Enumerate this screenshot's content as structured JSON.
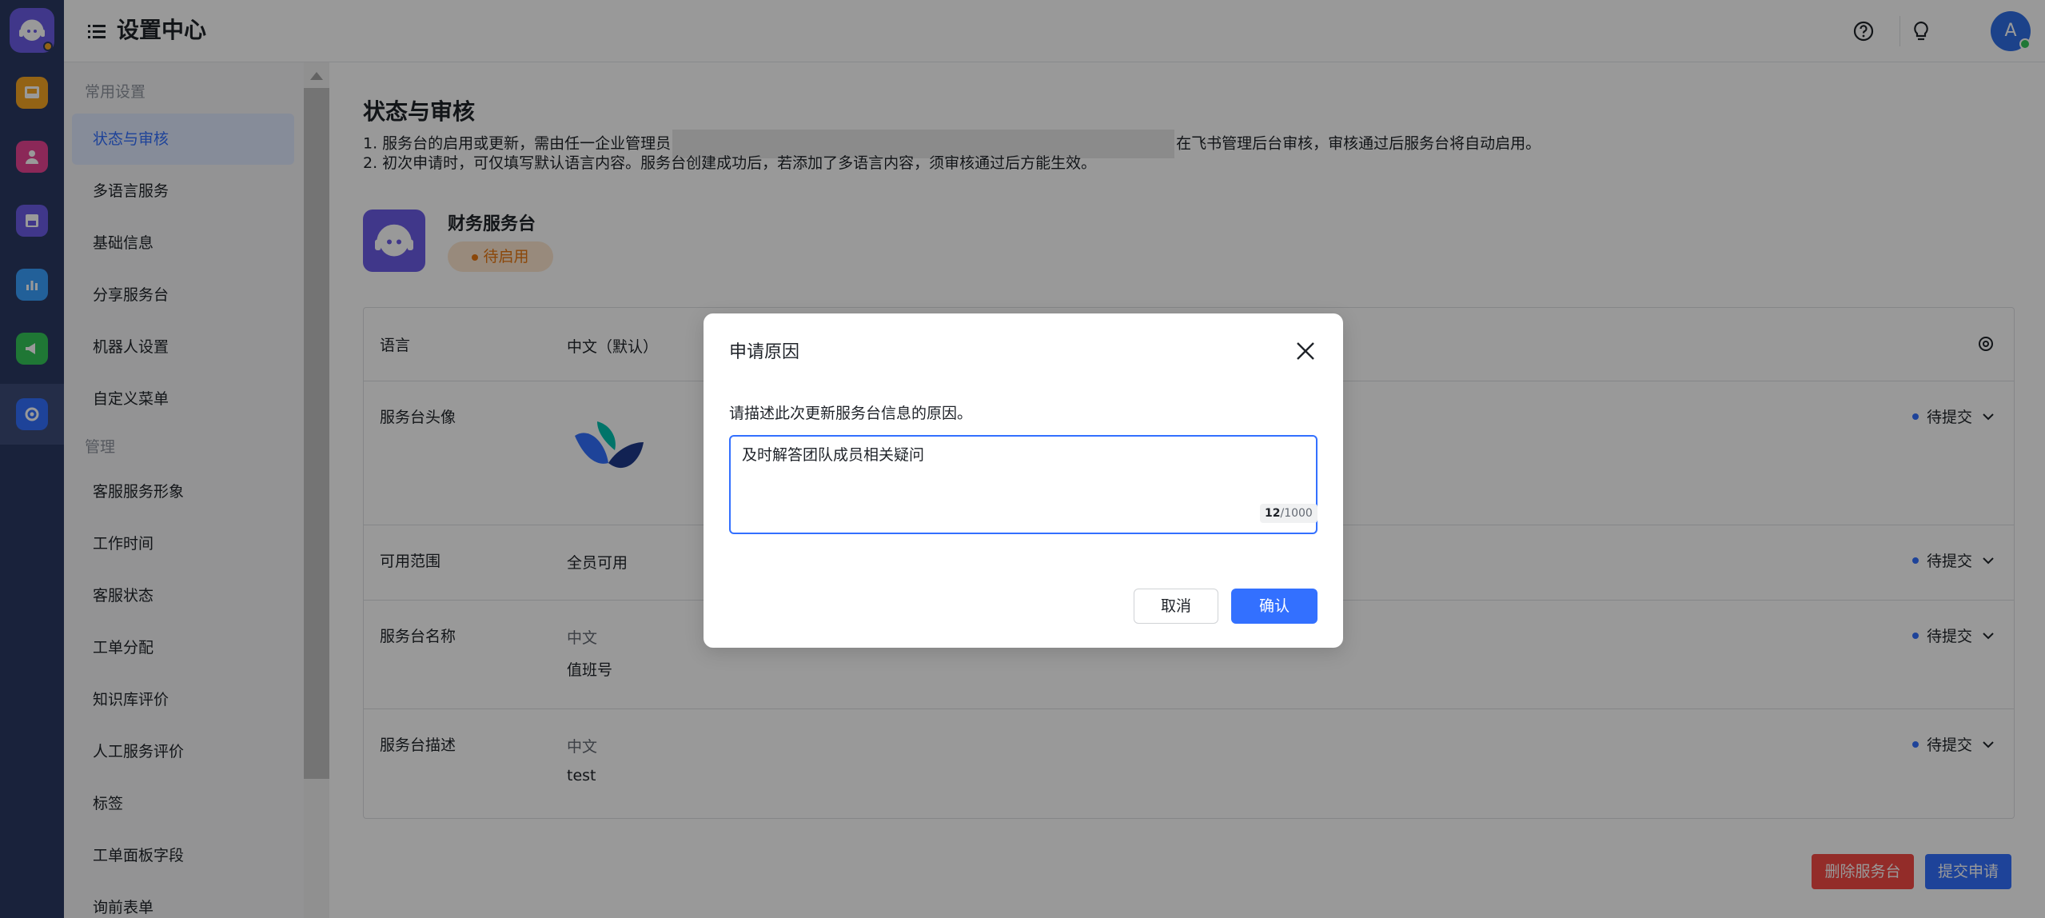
{
  "header": {
    "title": "设置中心",
    "avatar_letter": "A"
  },
  "sidebar": {
    "group_common": "常用设置",
    "group_manage": "管理",
    "items": [
      {
        "label": "状态与审核"
      },
      {
        "label": "多语言服务"
      },
      {
        "label": "基础信息"
      },
      {
        "label": "分享服务台"
      },
      {
        "label": "机器人设置"
      },
      {
        "label": "自定义菜单"
      },
      {
        "label": "客服服务形象"
      },
      {
        "label": "工作时间"
      },
      {
        "label": "客服状态"
      },
      {
        "label": "工单分配"
      },
      {
        "label": "知识库评价"
      },
      {
        "label": "人工服务评价"
      },
      {
        "label": "标签"
      },
      {
        "label": "工单面板字段"
      },
      {
        "label": "询前表单"
      }
    ]
  },
  "main": {
    "section_title": "状态与审核",
    "note1_prefix": "1. 服务台的启用或更新，需由任一企业管理员",
    "note1_suffix": "在飞书管理后台审核，审核通过后服务台将自动启用。",
    "note2": "2. 初次申请时，可仅填写默认语言内容。服务台创建成功后，若添加了多语言内容，须审核通过后方能生效。",
    "desk_name": "财务服务台",
    "status_tag": "待启用",
    "rows": [
      {
        "label": "语言",
        "value": "中文（默认）"
      },
      {
        "label": "服务台头像",
        "status": "待提交"
      },
      {
        "label": "可用范围",
        "value": "全员可用",
        "status": "待提交"
      },
      {
        "label": "服务台名称",
        "sub": "中文",
        "value": "值班号",
        "status": "待提交"
      },
      {
        "label": "服务台描述",
        "sub": "中文",
        "value": "test",
        "status": "待提交"
      }
    ],
    "delete_button": "删除服务台",
    "submit_button": "提交申请"
  },
  "modal": {
    "title": "申请原因",
    "description": "请描述此次更新服务台信息的原因。",
    "textarea_value": "及时解答团队成员相关疑问",
    "counter_current": "12",
    "counter_max": "/1000",
    "cancel_label": "取消",
    "ok_label": "确认"
  },
  "colors": {
    "primary": "#3370ff",
    "danger": "#f54a45",
    "warning": "#e8770f",
    "rail": "#2b3a63",
    "brand": "#6c5ce7"
  },
  "icons": [
    "menu-icon",
    "help-icon",
    "lightbulb-icon",
    "settings-icon",
    "chevron-down-icon",
    "close-icon"
  ]
}
